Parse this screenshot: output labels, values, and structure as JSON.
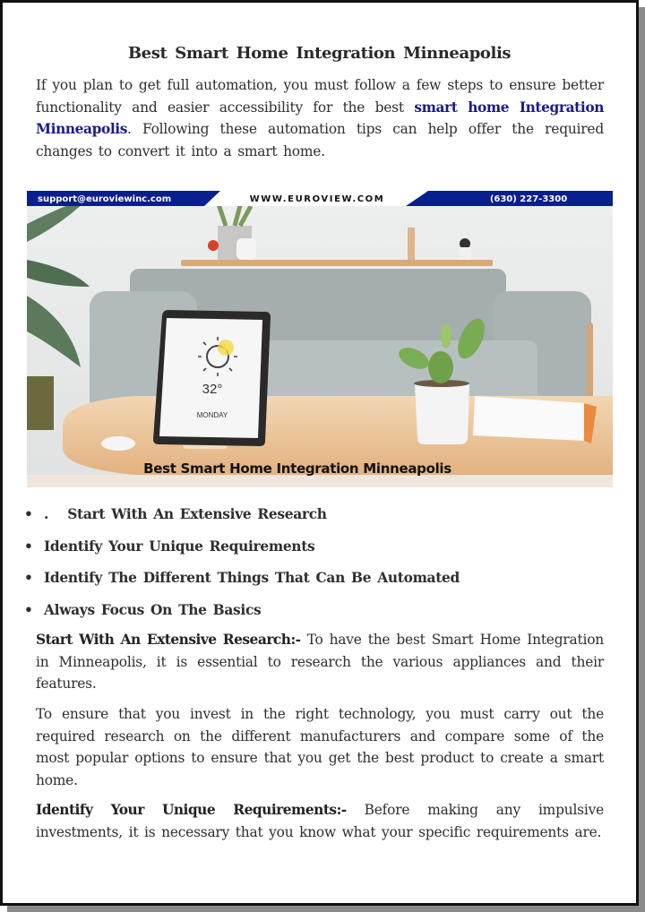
{
  "document": {
    "title": "Best Smart Home Integration Minneapolis",
    "intro": {
      "before_link": "If you plan to get full automation, you must follow a few steps to ensure better functionality and easier accessibility for the best ",
      "link_text": "smart home Integration Minneapolis",
      "after_link": ". Following these automation tips can help offer the required changes to convert it into a smart home."
    },
    "colors": {
      "link": "#1a1a8c",
      "banner_blue": "#0a1f8f",
      "text": "#2e2e2e"
    },
    "hero_image": {
      "alt": "Smart home living room with tablet showing weather",
      "banner": {
        "email": "support@euroviewinc.com",
        "website": "WWW.EUROVIEW.COM",
        "phone": "(630) 227-3300"
      },
      "tablet": {
        "temperature": "32°",
        "day": "MONDAY"
      },
      "caption": "Best Smart Home Integration Minneapolis"
    },
    "bullets": [
      {
        "marker": "•",
        "text": ".   Start With An Extensive Research"
      },
      {
        "marker": "•",
        "text": "Identify Your Unique Requirements"
      },
      {
        "marker": "•",
        "text": "Identify The Different Things That Can Be Automated"
      },
      {
        "marker": "•",
        "text": "Always Focus On The Basics"
      }
    ],
    "sections": [
      {
        "heading": "Start With An Extensive Research:-",
        "body": " To have the best Smart Home Integration in Minneapolis, it is essential to research the various appliances and their features."
      },
      {
        "heading": "",
        "body": "To ensure that you invest in the right technology, you must carry out the required research on the different manufacturers and compare some of the most popular options to ensure that you get the best product to create a smart home."
      },
      {
        "heading": "Identify Your Unique Requirements:-",
        "body": " Before making any impulsive investments, it is necessary that you know what your specific requirements are."
      }
    ]
  }
}
